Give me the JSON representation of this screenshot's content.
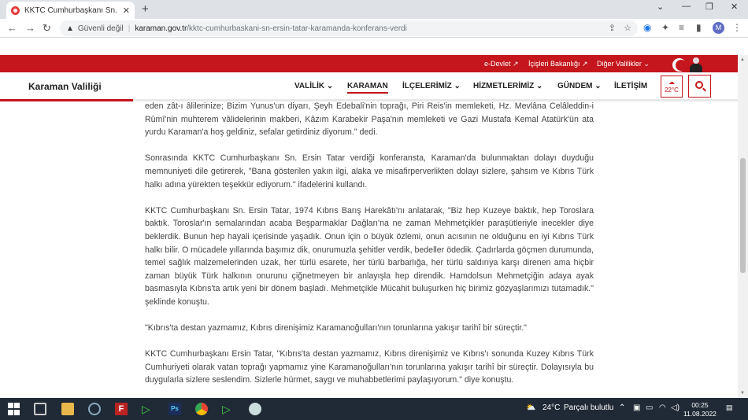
{
  "browser": {
    "tab_title": "KKTC Cumhurbaşkanı Sn. Ersin Ta",
    "tab_close": "✕",
    "new_tab": "+",
    "security_warning": "Güvenli değil",
    "url_host": "karaman.gov.tr",
    "url_path": "/kktc-cumhurbaskani-sn-ersin-tatar-karamanda-konferans-verdi",
    "profile_initial": "M",
    "window_controls": [
      "⌄",
      "—",
      "❐",
      "✕"
    ]
  },
  "topbar": {
    "links": [
      "e-Devlet ↗",
      "İçişleri Bakanlığı ↗",
      "Diğer Valilikler ⌄"
    ]
  },
  "site": {
    "brand": "Karaman Valiliği",
    "menu": [
      "VALİLİK ⌄",
      "KARAMAN",
      "İLÇELERİMİZ ⌄",
      "HİZMETLERİMİZ ⌄",
      "GÜNDEM ⌄",
      "İLETİŞİM"
    ],
    "active_menu": "KARAMAN",
    "weather_temp": "22°C",
    "reading_progress_percent": 18
  },
  "article": {
    "paragraphs": [
      "eden zât-ı âlilerinize; Bizim Yunus'un diyarı, Şeyh Edebali'nin toprağı, Piri Reis'in memleketi, Hz. Mevlâna Celâleddin-i Rûmî'nin muhterem vâlidelerinin makberi, Kâzım Karabekir Paşa'nın memleketi ve Gazi Mustafa Kemal Atatürk'ün ata yurdu Karaman'a hoş geldiniz, sefalar getirdiniz diyorum.\" dedi.",
      "Sonrasında KKTC Cumhurbaşkanı Sn. Ersin Tatar verdiği konferansta, Karaman'da bulunmaktan dolayı duyduğu memnuniyeti dile getirerek, \"Bana gösterilen yakın ilgi, alaka ve misafirperverlikten dolayı sizlere, şahsım ve Kıbrıs Türk halkı adına yürekten teşekkür ediyorum.\" ifadelerini kullandı.",
      "KKTC Cumhurbaşkanı Sn. Ersin Tatar, 1974 Kıbrıs Barış Harekâtı'nı anlatarak, \"Biz hep Kuzeye baktık, hep Toroslara baktık. Toroslar'ın semalarından acaba Beşparmaklar Dağları'na ne zaman Mehmetçikler paraşütleriyle inecekler diye beklerdik. Bunun hep hayali içerisinde yaşadık. Onun için o büyük özlemi, onun acısının ne olduğunu en iyi Kıbrıs Türk halkı bilir. O mücadele yıllarında başımız dik, onurumuzla şehitler verdik, bedeller ödedik. Çadırlarda göçmen durumunda, temel sağlık malzemelerinden uzak, her türlü esarete, her türlü barbarlığa, her türlü saldırıya karşı direnen ama hiçbir zaman büyük Türk halkının onurunu çiğnetmeyen bir anlayışla hep direndik. Hamdolsun Mehmetçiğin adaya ayak basmasıyla Kıbrıs'ta artık yeni bir dönem başladı. Mehmetçikle Mücahit buluşurken hiç birimiz gözyaşlarımızı tutamadık.\" şeklinde konuştu.",
      "\"Kıbrıs'ta destan yazmamız, Kıbrıs direnişimiz Karamanoğulları'nın torunlarına yakışır tarihî bir süreçtir.\"",
      "KKTC Cumhurbaşkanı Ersin Tatar, \"Kıbrıs'ta destan yazmamız, Kıbrıs direnişimiz ve Kıbrıs'ı sonunda Kuzey Kıbrıs Türk Cumhuriyeti olarak vatan toprağı yapmamız yine Karamanoğulları'nın torunlarına yakışır tarihî bir süreçtir. Dolayısıyla bu duygularla sizlere seslendim. Sizlerle hürmet, saygı ve muhabbetlerimi paylaşıyorum.\" diye konuştu."
    ]
  },
  "taskbar": {
    "weather": "24°C",
    "weather_desc": "Parçalı bulutlu",
    "time": "00:25",
    "date": "11.08.2022",
    "notifications": "2"
  }
}
